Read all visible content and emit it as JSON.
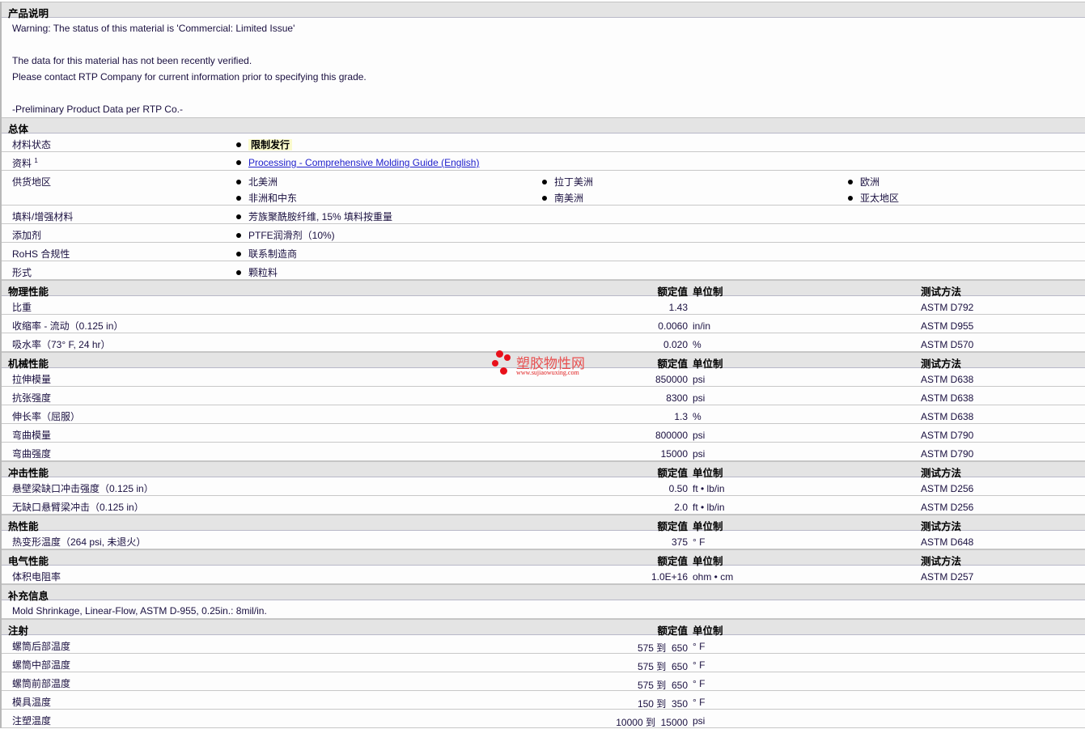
{
  "description": {
    "title": "产品说明",
    "lines": [
      "Warning: The status of this material is 'Commercial: Limited Issue'",
      "The data for this material has not been recently verified.",
      "Please contact RTP Company for current information prior to specifying this grade.",
      "-Preliminary Product Data per RTP Co.-"
    ]
  },
  "general": {
    "title": "总体",
    "status_label": "材料状态",
    "status_value": "限制发行",
    "docs_label": "资料",
    "docs_sup": "1",
    "docs_link": "Processing - Comprehensive Molding Guide (English)",
    "regions_label": "供货地区",
    "regions": [
      "北美洲",
      "拉丁美洲",
      "欧洲",
      "非洲和中东",
      "南美洲",
      "亚太地区"
    ],
    "filler_label": "填料/增强材料",
    "filler_value": "芳族聚酰胺纤维, 15% 填料按重量",
    "additive_label": "添加剂",
    "additive_value": "PTFE润滑剂（10%)",
    "rohs_label": "RoHS 合规性",
    "rohs_value": "联系制造商",
    "form_label": "形式",
    "form_value": "颗粒料"
  },
  "col": {
    "value": "额定值",
    "unit": "单位制",
    "method": "测试方法"
  },
  "sections": [
    {
      "title": "物理性能",
      "rows": [
        [
          "比重",
          "1.43",
          "",
          "ASTM D792"
        ],
        [
          "收缩率 - 流动（0.125 in）",
          "0.0060",
          "in/in",
          "ASTM D955"
        ],
        [
          "吸水率（73° F, 24 hr）",
          "0.020",
          "%",
          "ASTM D570"
        ]
      ]
    },
    {
      "title": "机械性能",
      "rows": [
        [
          "拉伸模量",
          "850000",
          "psi",
          "ASTM D638"
        ],
        [
          "抗张强度",
          "8300",
          "psi",
          "ASTM D638"
        ],
        [
          "伸长率（屈服）",
          "1.3",
          "%",
          "ASTM D638"
        ],
        [
          "弯曲模量",
          "800000",
          "psi",
          "ASTM D790"
        ],
        [
          "弯曲强度",
          "15000",
          "psi",
          "ASTM D790"
        ]
      ]
    },
    {
      "title": "冲击性能",
      "rows": [
        [
          "悬壁梁缺口冲击强度（0.125 in）",
          "0.50",
          "ft • lb/in",
          "ASTM D256"
        ],
        [
          "无缺口悬臂梁冲击（0.125 in）",
          "2.0",
          "ft • lb/in",
          "ASTM D256"
        ]
      ]
    },
    {
      "title": "热性能",
      "rows": [
        [
          "热变形温度（264 psi, 未退火）",
          "375",
          "° F",
          "ASTM D648"
        ]
      ]
    },
    {
      "title": "电气性能",
      "rows": [
        [
          "体积电阻率",
          "1.0E+16",
          "ohm • cm",
          "ASTM D257"
        ]
      ]
    }
  ],
  "supplement": {
    "title": "补充信息",
    "text": "Mold Shrinkage, Linear-Flow, ASTM D-955, 0.25in.: 8mil/in."
  },
  "injection": {
    "title": "注射",
    "rows": [
      [
        "螺筒后部温度",
        "575 到  650",
        "° F"
      ],
      [
        "螺筒中部温度",
        "575 到  650",
        "° F"
      ],
      [
        "螺筒前部温度",
        "575 到  650",
        "° F"
      ],
      [
        "模具温度",
        "150 到  350",
        "° F"
      ],
      [
        "注塑温度",
        "10000 到  15000",
        "psi"
      ]
    ]
  },
  "watermark": {
    "name": "塑胶物性网",
    "url": "www.sujiaowuxing.com"
  }
}
